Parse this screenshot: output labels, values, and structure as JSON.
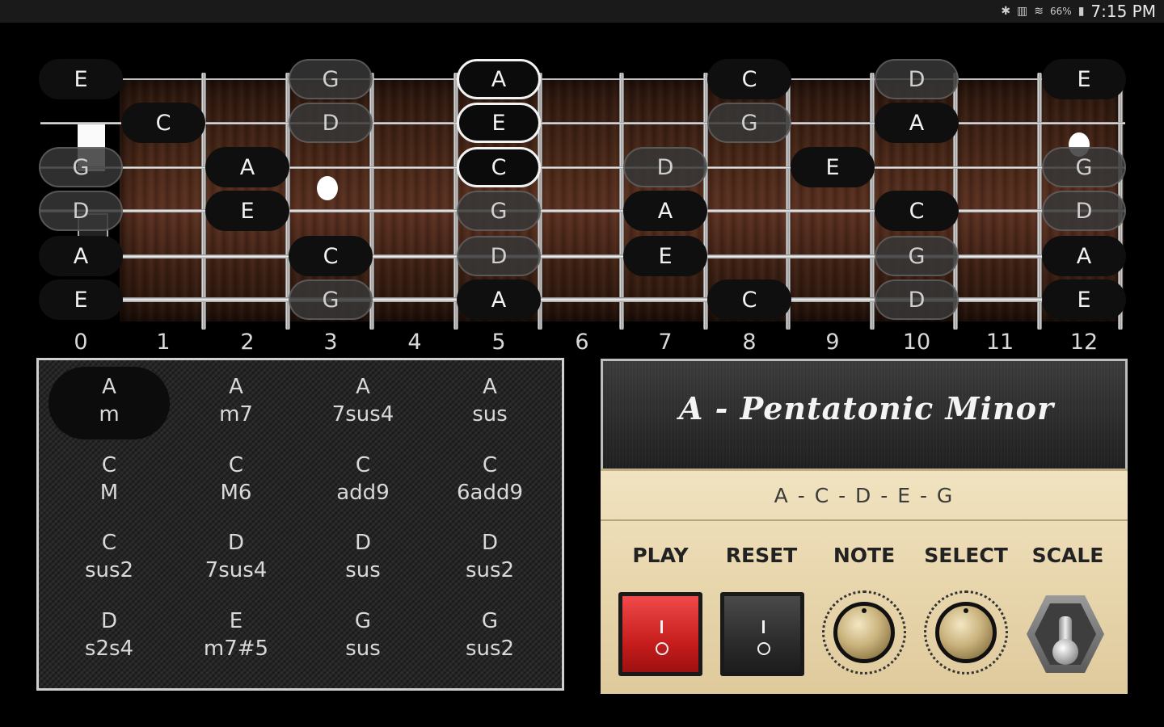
{
  "status_bar": {
    "icons": [
      "bluetooth-icon",
      "vibrate-icon",
      "wifi-icon"
    ],
    "battery": "66%",
    "time": "7:15 PM"
  },
  "fretboard": {
    "fret_numbers": [
      "0",
      "1",
      "2",
      "3",
      "4",
      "5",
      "6",
      "7",
      "8",
      "9",
      "10",
      "11",
      "12"
    ],
    "notes": {
      "s1": [
        "E",
        "C",
        "G",
        "A",
        "C",
        "D",
        "E"
      ],
      "s2": [
        "C",
        "D",
        "E",
        "G",
        "A"
      ],
      "s3": [
        "G",
        "A",
        "C",
        "D",
        "E",
        "G"
      ],
      "s4": [
        "D",
        "E",
        "G",
        "A",
        "C",
        "D"
      ],
      "s5": [
        "A",
        "C",
        "D",
        "E",
        "G",
        "A"
      ],
      "s6": [
        "E",
        "G",
        "A",
        "C",
        "D",
        "E"
      ]
    }
  },
  "chords": [
    {
      "root": "A",
      "type": "m"
    },
    {
      "root": "A",
      "type": "m7"
    },
    {
      "root": "A",
      "type": "7sus4"
    },
    {
      "root": "A",
      "type": "sus"
    },
    {
      "root": "C",
      "type": "M"
    },
    {
      "root": "C",
      "type": "M6"
    },
    {
      "root": "C",
      "type": "add9"
    },
    {
      "root": "C",
      "type": "6add9"
    },
    {
      "root": "C",
      "type": "sus2"
    },
    {
      "root": "D",
      "type": "7sus4"
    },
    {
      "root": "D",
      "type": "sus"
    },
    {
      "root": "D",
      "type": "sus2"
    },
    {
      "root": "D",
      "type": "s2s4"
    },
    {
      "root": "E",
      "type": "m7#5"
    },
    {
      "root": "G",
      "type": "sus"
    },
    {
      "root": "G",
      "type": "sus2"
    }
  ],
  "amp": {
    "scale_title": "A - Pentatonic Minor",
    "scale_notes": "A - C - D - E - G",
    "controls": {
      "play": "PLAY",
      "reset": "RESET",
      "note": "NOTE",
      "select": "SELECT",
      "scale": "SCALE"
    },
    "switch_on_symbol": "I",
    "switch_off_symbol": "O"
  },
  "colors": {
    "play_switch": "#d42828",
    "amp_panel": "#ecdcb5",
    "selected_note_border": "#f2f2f2"
  }
}
